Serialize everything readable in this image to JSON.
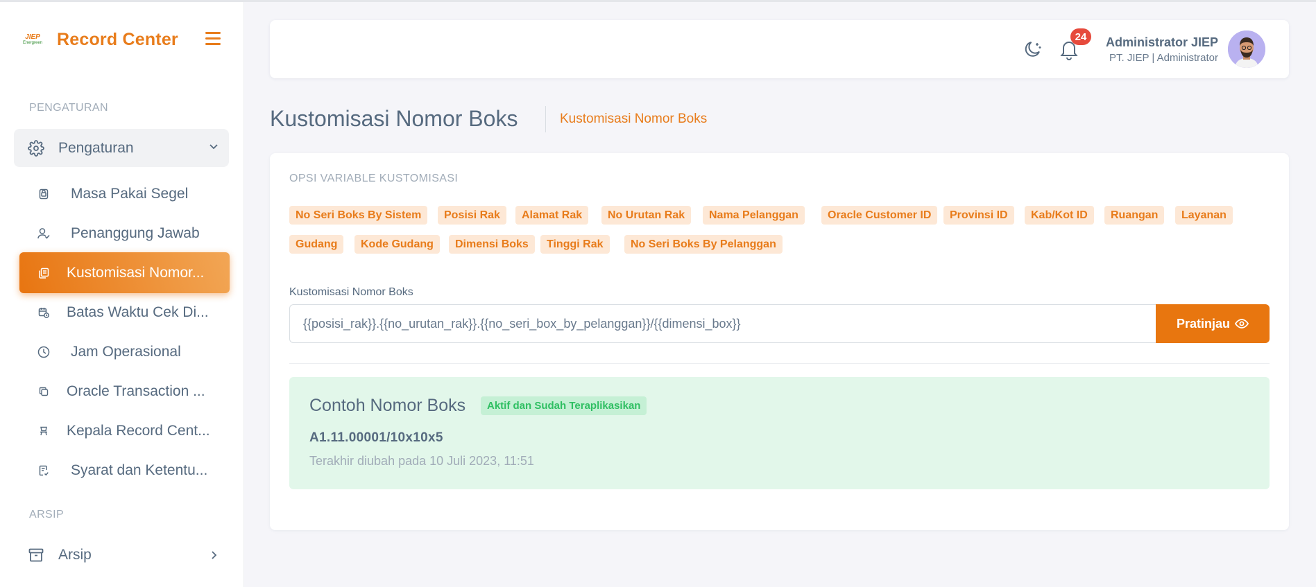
{
  "brand": {
    "name": "Record Center",
    "logo_text": "JIEP",
    "logo_subtext": "Energreen"
  },
  "sidebar": {
    "section_pengaturan": "PENGATURAN",
    "group_pengaturan": "Pengaturan",
    "items": [
      {
        "label": "Masa Pakai Segel",
        "icon": "seal-icon"
      },
      {
        "label": "Penanggung Jawab",
        "icon": "user-check-icon"
      },
      {
        "label": "Kustomisasi Nomor...",
        "icon": "copy-icon",
        "active": true
      },
      {
        "label": "Batas Waktu Cek Di...",
        "icon": "calendar-clock-icon"
      },
      {
        "label": "Jam Operasional",
        "icon": "clock-icon"
      },
      {
        "label": "Oracle Transaction ...",
        "icon": "stack-icon"
      },
      {
        "label": "Kepala Record Cent...",
        "icon": "chair-icon"
      },
      {
        "label": "Syarat dan Ketentu...",
        "icon": "document-check-icon"
      }
    ],
    "section_arsip": "ARSIP",
    "group_arsip": "Arsip"
  },
  "navbar": {
    "notification_count": "24",
    "user_name": "Administrator JIEP",
    "user_role": "PT. JIEP | Administrator"
  },
  "page": {
    "title": "Kustomisasi Nomor Boks",
    "breadcrumb": "Kustomisasi Nomor Boks"
  },
  "card": {
    "section_label": "OPSI VARIABLE KUSTOMISASI",
    "chips": [
      "No Seri Boks By Sistem",
      "Posisi Rak",
      "Alamat Rak",
      "No Urutan Rak",
      "Nama Pelanggan",
      "Oracle Customer ID",
      "Provinsi ID",
      "Kab/Kot ID",
      "Ruangan",
      "Layanan",
      "Gudang",
      "Kode Gudang",
      "Dimensi Boks",
      "Tinggi Rak",
      "No Seri Boks By Pelanggan"
    ],
    "field_label": "Kustomisasi Nomor Boks",
    "field_value": "{{posisi_rak}}.{{no_urutan_rak}}.{{no_seri_box_by_pelanggan}}/{{dimensi_box}}",
    "preview_button": "Pratinjau",
    "example": {
      "title": "Contoh Nomor Boks",
      "badge": "Aktif dan Sudah Teraplikasikan",
      "value": "A1.11.00001/10x10x5",
      "updated": "Terakhir diubah pada 10 Juli 2023, 11:51"
    }
  },
  "colors": {
    "accent": "#e87c1b",
    "success_bg": "#e2f7ea",
    "success_text": "#2fbf62",
    "badge_red": "#e64a3c"
  }
}
